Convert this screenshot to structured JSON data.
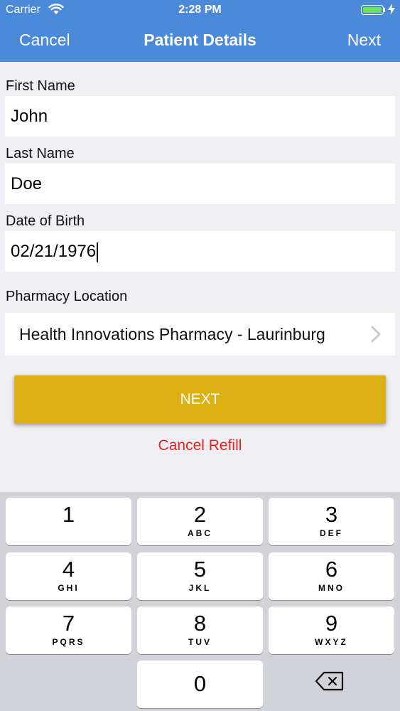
{
  "status_bar": {
    "carrier": "Carrier",
    "time": "2:28 PM"
  },
  "nav": {
    "cancel": "Cancel",
    "title": "Patient Details",
    "next": "Next"
  },
  "form": {
    "first_name": {
      "label": "First Name",
      "value": "John"
    },
    "last_name": {
      "label": "Last Name",
      "value": "Doe"
    },
    "dob": {
      "label": "Date of Birth",
      "value": "02/21/1976"
    },
    "pharmacy": {
      "label": "Pharmacy Location",
      "value": "Health Innovations Pharmacy - Laurinburg"
    }
  },
  "actions": {
    "next_button": "NEXT",
    "cancel_refill": "Cancel Refill"
  },
  "keypad": {
    "keys": [
      {
        "num": "1",
        "letters": ""
      },
      {
        "num": "2",
        "letters": "ABC"
      },
      {
        "num": "3",
        "letters": "DEF"
      },
      {
        "num": "4",
        "letters": "GHI"
      },
      {
        "num": "5",
        "letters": "JKL"
      },
      {
        "num": "6",
        "letters": "MNO"
      },
      {
        "num": "7",
        "letters": "PQRS"
      },
      {
        "num": "8",
        "letters": "TUV"
      },
      {
        "num": "9",
        "letters": "WXYZ"
      },
      {
        "num": "0",
        "letters": ""
      }
    ]
  },
  "colors": {
    "header": "#4a8ad8",
    "next_button": "#ddb115",
    "cancel_refill": "#e8221c",
    "keypad_bg": "#d1d3d9"
  },
  "icons": [
    "wifi-icon",
    "battery-icon",
    "charging-bolt-icon",
    "chevron-right-icon",
    "backspace-icon"
  ]
}
